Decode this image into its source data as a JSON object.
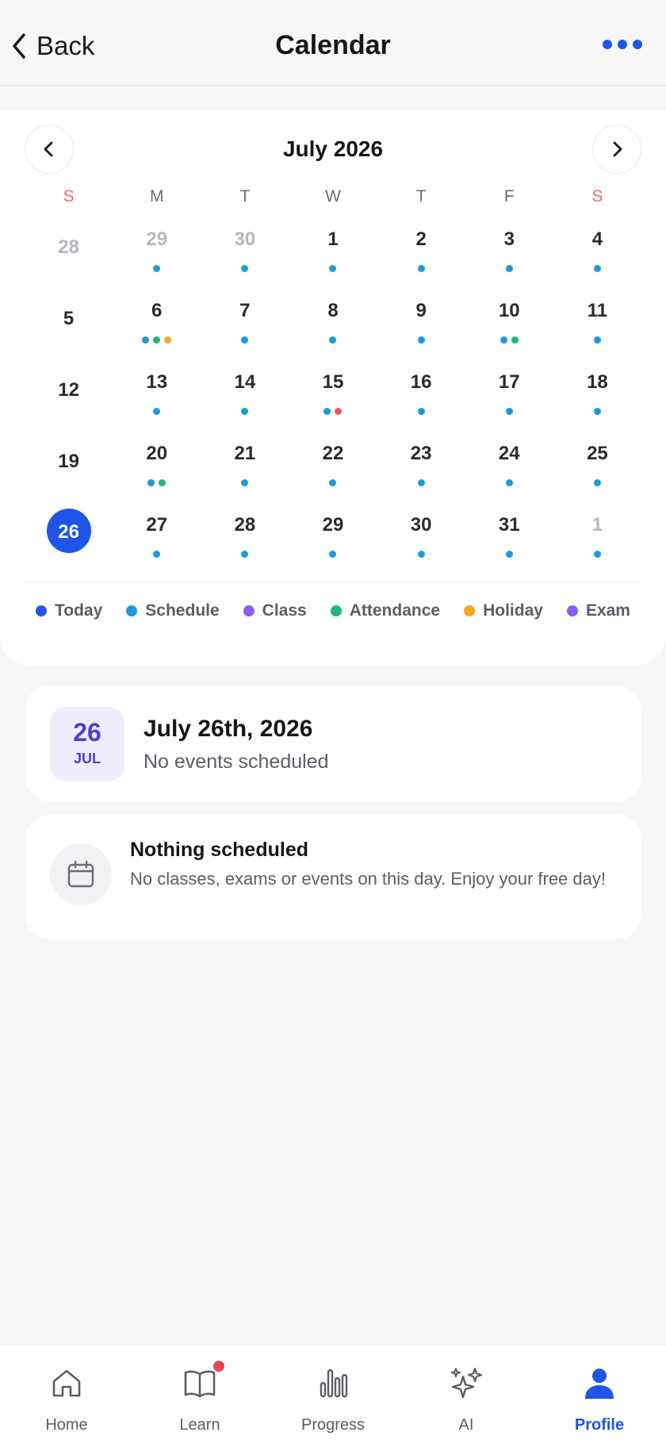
{
  "header": {
    "back_label": "Back",
    "title": "Calendar",
    "more_icon": "more-horizontal-icon"
  },
  "calendar": {
    "month_title": "July 2026",
    "weekdays": [
      "S",
      "M",
      "T",
      "W",
      "T",
      "F",
      "S"
    ],
    "weeks": [
      [
        {
          "day": "28",
          "muted": true,
          "dots": []
        },
        {
          "day": "29",
          "muted": true,
          "dots": [
            "schedule"
          ]
        },
        {
          "day": "30",
          "muted": true,
          "dots": [
            "schedule"
          ]
        },
        {
          "day": "1",
          "dots": [
            "schedule"
          ]
        },
        {
          "day": "2",
          "dots": [
            "schedule"
          ]
        },
        {
          "day": "3",
          "dots": [
            "schedule"
          ]
        },
        {
          "day": "4",
          "dots": [
            "schedule"
          ]
        }
      ],
      [
        {
          "day": "5",
          "dots": []
        },
        {
          "day": "6",
          "dots": [
            "schedule",
            "attendance",
            "holiday"
          ]
        },
        {
          "day": "7",
          "dots": [
            "schedule"
          ]
        },
        {
          "day": "8",
          "dots": [
            "schedule"
          ]
        },
        {
          "day": "9",
          "dots": [
            "schedule"
          ]
        },
        {
          "day": "10",
          "dots": [
            "schedule",
            "attendance"
          ]
        },
        {
          "day": "11",
          "dots": [
            "schedule"
          ]
        }
      ],
      [
        {
          "day": "12",
          "dots": []
        },
        {
          "day": "13",
          "dots": [
            "schedule"
          ]
        },
        {
          "day": "14",
          "dots": [
            "schedule"
          ]
        },
        {
          "day": "15",
          "dots": [
            "schedule",
            "red"
          ]
        },
        {
          "day": "16",
          "dots": [
            "schedule"
          ]
        },
        {
          "day": "17",
          "dots": [
            "schedule"
          ]
        },
        {
          "day": "18",
          "dots": [
            "schedule"
          ]
        }
      ],
      [
        {
          "day": "19",
          "dots": []
        },
        {
          "day": "20",
          "dots": [
            "schedule",
            "attendance"
          ]
        },
        {
          "day": "21",
          "dots": [
            "schedule"
          ]
        },
        {
          "day": "22",
          "dots": [
            "schedule"
          ]
        },
        {
          "day": "23",
          "dots": [
            "schedule"
          ]
        },
        {
          "day": "24",
          "dots": [
            "schedule"
          ]
        },
        {
          "day": "25",
          "dots": [
            "schedule"
          ]
        }
      ],
      [
        {
          "day": "26",
          "today": true,
          "dots": []
        },
        {
          "day": "27",
          "dots": [
            "schedule"
          ]
        },
        {
          "day": "28",
          "dots": [
            "schedule"
          ]
        },
        {
          "day": "29",
          "dots": [
            "schedule"
          ]
        },
        {
          "day": "30",
          "dots": [
            "schedule"
          ]
        },
        {
          "day": "31",
          "dots": [
            "schedule"
          ]
        },
        {
          "day": "1",
          "muted": true,
          "dots": [
            "schedule"
          ]
        }
      ]
    ],
    "legend": [
      {
        "key": "today",
        "label": "Today"
      },
      {
        "key": "schedule",
        "label": "Schedule"
      },
      {
        "key": "class",
        "label": "Class"
      },
      {
        "key": "attendance",
        "label": "Attendance"
      },
      {
        "key": "holiday",
        "label": "Holiday"
      },
      {
        "key": "exam",
        "label": "Exam"
      }
    ],
    "colors": {
      "today": "#1e55e6",
      "schedule": "#1e9ad6",
      "class": "#8b5cf6",
      "attendance": "#1db87a",
      "holiday": "#f5a623",
      "exam": "#8b5cf6",
      "red": "#e85a60"
    }
  },
  "selected_date": {
    "badge_day": "26",
    "badge_month": "JUL",
    "title": "July 26th, 2026",
    "subtitle": "No events scheduled"
  },
  "empty_state": {
    "icon": "calendar-icon",
    "title": "Nothing scheduled",
    "description": "No classes, exams or events on this day. Enjoy your free day!"
  },
  "tabbar": {
    "tabs": [
      {
        "id": "home",
        "label": "Home",
        "icon": "home-icon"
      },
      {
        "id": "learn",
        "label": "Learn",
        "icon": "book-icon",
        "badge": true
      },
      {
        "id": "progress",
        "label": "Progress",
        "icon": "bar-chart-icon"
      },
      {
        "id": "ai",
        "label": "AI",
        "icon": "sparkles-icon"
      },
      {
        "id": "profile",
        "label": "Profile",
        "icon": "user-icon",
        "active": true
      }
    ]
  }
}
